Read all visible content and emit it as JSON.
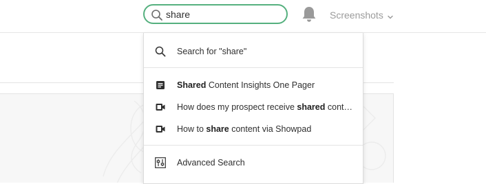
{
  "header": {
    "search": {
      "value": "share",
      "placeholder": ""
    },
    "workspace_label": "Screenshots"
  },
  "dropdown": {
    "search_for": "Search for \"share\"",
    "results": [
      {
        "icon": "document-icon",
        "pre": "",
        "bold": "Shared",
        "post": " Content Insights One Pager"
      },
      {
        "icon": "video-icon",
        "pre": "How does my prospect receive ",
        "bold": "shared",
        "post": " conte…"
      },
      {
        "icon": "video-icon",
        "pre": "How to ",
        "bold": "share",
        "post": " content via Showpad"
      }
    ],
    "advanced_search": "Advanced Search"
  },
  "colors": {
    "accent": "#55b07e",
    "muted": "#9b9b9b",
    "text": "#2f2f2f"
  }
}
